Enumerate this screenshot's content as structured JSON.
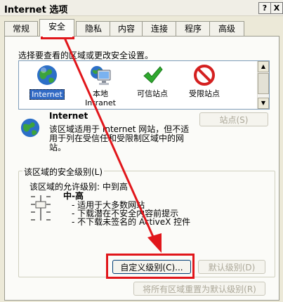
{
  "window": {
    "title": "Internet 选项",
    "help_btn": "?",
    "close_btn": "X"
  },
  "tabs": [
    {
      "label": "常规"
    },
    {
      "label": "安全"
    },
    {
      "label": "隐私"
    },
    {
      "label": "内容"
    },
    {
      "label": "连接"
    },
    {
      "label": "程序"
    },
    {
      "label": "高级"
    }
  ],
  "security": {
    "prompt": "选择要查看的区域或更改安全设置。",
    "zones": [
      {
        "name": "Internet",
        "icon": "globe-icon"
      },
      {
        "name": "本地\nIntranet",
        "icon": "monitor-icon"
      },
      {
        "name": "可信站点",
        "icon": "checkmark-icon"
      },
      {
        "name": "受限站点",
        "icon": "no-entry-icon"
      }
    ],
    "zone_info": {
      "name": "Internet",
      "description": "该区域适用于 Internet 网站，但不适用于列在受信任和受限制区域中的网站。"
    },
    "sites_button": "站点(S)",
    "level_group_title": "该区域的安全级别(L)",
    "allowed_levels": "该区域的允许级别: 中到高",
    "level_name": "中-高",
    "bullets": [
      "- 适用于大多数网站",
      "- 下载潜在不安全内容前提示",
      "- 不下载未签名的 ActiveX 控件"
    ],
    "custom_level_button": "自定义级别(C)...",
    "default_level_button": "默认级别(D)",
    "reset_all_button": "将所有区域重置为默认级别(R)"
  },
  "colors": {
    "highlight": "#316AC5",
    "annotation": "#E1161B"
  }
}
